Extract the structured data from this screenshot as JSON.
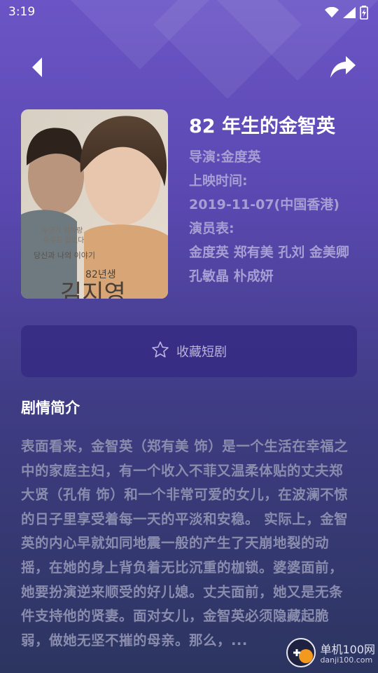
{
  "status_bar": {
    "time": "3:19"
  },
  "movie": {
    "title": "82 年生的金智英",
    "director": "导演:金度英",
    "release_label": "上映时间:",
    "release_date": "2019-11-07(中国香港)",
    "cast_label": "演员表:",
    "cast": "金度英 郑有美 孔刘 金美卿 孔敏晶 朴成妍"
  },
  "poster": {
    "tagline": "당신과 나의 이야기",
    "title_ko": "82년생",
    "title_ko_2": "김지영"
  },
  "actions": {
    "collect_label": "收藏短剧"
  },
  "synopsis": {
    "heading": "剧情简介",
    "text": "表面看来，金智英（郑有美 饰）是一个生活在幸福之中的家庭主妇，有一个收入不菲又温柔体贴的丈夫郑大贤（孔侑 饰）和一个非常可爱的女儿，在波澜不惊的日子里享受着每一天的平淡和安稳。 实际上，金智英的内心早就如同地震一般的产生了天崩地裂的动摇，在她的身上背负着无比沉重的枷锁。婆婆面前，她要扮演逆来顺受的好儿媳。丈夫面前，她又是无条件支持他的贤妻。面对女儿，金智英必须隐藏起脆弱，做她无坚不摧的母亲。那么，..."
  },
  "watermark": {
    "text": "单机100网",
    "sub": "danji100.com"
  },
  "colors": {
    "accent": "#6b55c6",
    "meta": "#a79fd4",
    "synopsis": "#8a8cad"
  }
}
